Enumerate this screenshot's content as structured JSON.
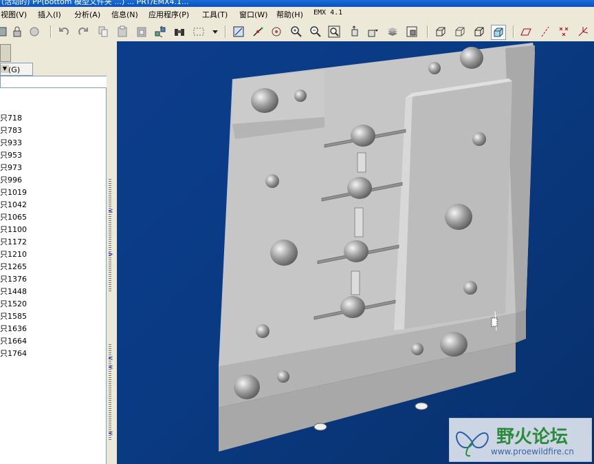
{
  "title_bar": {
    "text": "(活动的) PP(bottom 模型文件夹 ...) ... PRT/EMX4.1..."
  },
  "menu": [
    {
      "label": "视图(V)"
    },
    {
      "label": "插入(I)"
    },
    {
      "label": "分析(A)"
    },
    {
      "label": "信息(N)"
    },
    {
      "label": "应用程序(P)"
    },
    {
      "label": "工具(T)"
    },
    {
      "label": "窗口(W)"
    },
    {
      "label": "帮助(H)"
    },
    {
      "label": "EMX 4.1"
    }
  ],
  "toolbar": {
    "icons": [
      "save-icon",
      "lock-icon",
      "print-icon",
      "undo-icon",
      "redo-icon",
      "copy-icon",
      "paste-icon",
      "paste-special-icon",
      "regenerate-icon",
      "binoculars-icon",
      "select-box-icon",
      "dropdown-icon",
      "sketch-view-icon",
      "datum-display-icon",
      "spin-center-icon",
      "zoom-in-icon",
      "zoom-out-icon",
      "refit-icon",
      "orient-icon",
      "saved-views-icon",
      "layers-icon",
      "view-manager-icon",
      "wireframe-icon",
      "hidden-line-icon",
      "no-hidden-icon",
      "shaded-icon",
      "datum-plane-icon",
      "datum-axis-icon",
      "datum-point-icon",
      "coord-sys-icon"
    ]
  },
  "left_panel": {
    "settings_label": "置(G)",
    "tree_items": [
      {
        "label": "只718"
      },
      {
        "label": "只783"
      },
      {
        "label": "只933"
      },
      {
        "label": "只953"
      },
      {
        "label": "只973"
      },
      {
        "label": "只996"
      },
      {
        "label": "只1019"
      },
      {
        "label": "只1042"
      },
      {
        "label": "只1065"
      },
      {
        "label": "只1100"
      },
      {
        "label": "只1172"
      },
      {
        "label": "只1210"
      },
      {
        "label": "只1265"
      },
      {
        "label": "只1376"
      },
      {
        "label": "只1448"
      },
      {
        "label": "只1520"
      },
      {
        "label": "只1585"
      },
      {
        "label": "只1636"
      },
      {
        "label": "只1664"
      },
      {
        "label": "只1764"
      }
    ]
  },
  "watermark": {
    "title": "野火论坛",
    "url": "www.proewildfire.cn"
  },
  "colors": {
    "viewport_bg": "#0a3a82",
    "part_gray": "#c8c8c8",
    "watermark_green": "#2a8b3a"
  }
}
